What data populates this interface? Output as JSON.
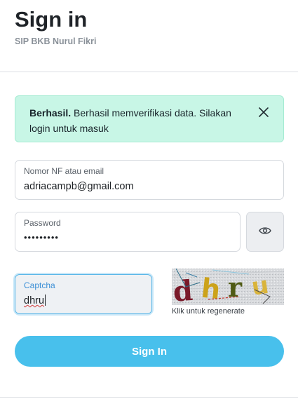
{
  "header": {
    "title": "Sign in",
    "subtitle": "SIP BKB Nurul Fikri"
  },
  "alert": {
    "strong": "Berhasil.",
    "message": "Berhasil memverifikasi data. Silakan login untuk masuk",
    "close_icon": "close-icon",
    "background": "#c8f6e6"
  },
  "form": {
    "email": {
      "label": "Nomor NF atau email",
      "value": "adriacampb@gmail.com"
    },
    "password": {
      "label": "Password",
      "value": "•••••••••",
      "toggle_icon": "eye-icon"
    },
    "captcha": {
      "label": "Captcha",
      "value": "dhru",
      "image_text": "dhru",
      "hint": "Klik untuk regenerate"
    },
    "submit_label": "Sign In"
  },
  "colors": {
    "accent": "#48c0ec",
    "focus_border": "#5ab7e8",
    "alert_bg": "#c8f6e6"
  }
}
